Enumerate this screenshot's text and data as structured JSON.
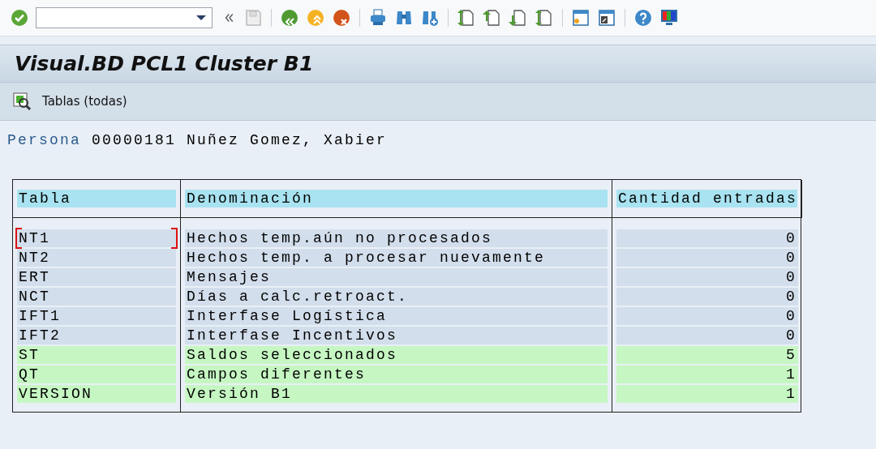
{
  "window": {
    "title": "Visual.BD PCL1 Cluster B1"
  },
  "app_toolbar": {
    "button": "Tablas (todas)"
  },
  "persona": {
    "label": "Persona",
    "number": "00000181",
    "name": "Nuñez Gomez, Xabier"
  },
  "table": {
    "columns": [
      "Tabla",
      "Denominación",
      "Cantidad entradas"
    ],
    "rows": [
      {
        "table": "NT1",
        "name": "Hechos temp.aún no procesados",
        "count": "0",
        "highlighted": false,
        "selected": true
      },
      {
        "table": "NT2",
        "name": "Hechos temp. a procesar nuevamente",
        "count": "0",
        "highlighted": false,
        "selected": false
      },
      {
        "table": "ERT",
        "name": "Mensajes",
        "count": "0",
        "highlighted": false,
        "selected": false
      },
      {
        "table": "NCT",
        "name": "Días a calc.retroact.",
        "count": "0",
        "highlighted": false,
        "selected": false
      },
      {
        "table": "IFT1",
        "name": "Interfase Logística",
        "count": "0",
        "highlighted": false,
        "selected": false
      },
      {
        "table": "IFT2",
        "name": "Interfase Incentivos",
        "count": "0",
        "highlighted": false,
        "selected": false
      },
      {
        "table": "ST",
        "name": "Saldos seleccionados",
        "count": "5",
        "highlighted": true,
        "selected": false
      },
      {
        "table": "QT",
        "name": "Campos diferentes",
        "count": "1",
        "highlighted": true,
        "selected": false
      },
      {
        "table": "VERSION",
        "name": "Versión B1",
        "count": "1",
        "highlighted": true,
        "selected": false
      }
    ]
  }
}
